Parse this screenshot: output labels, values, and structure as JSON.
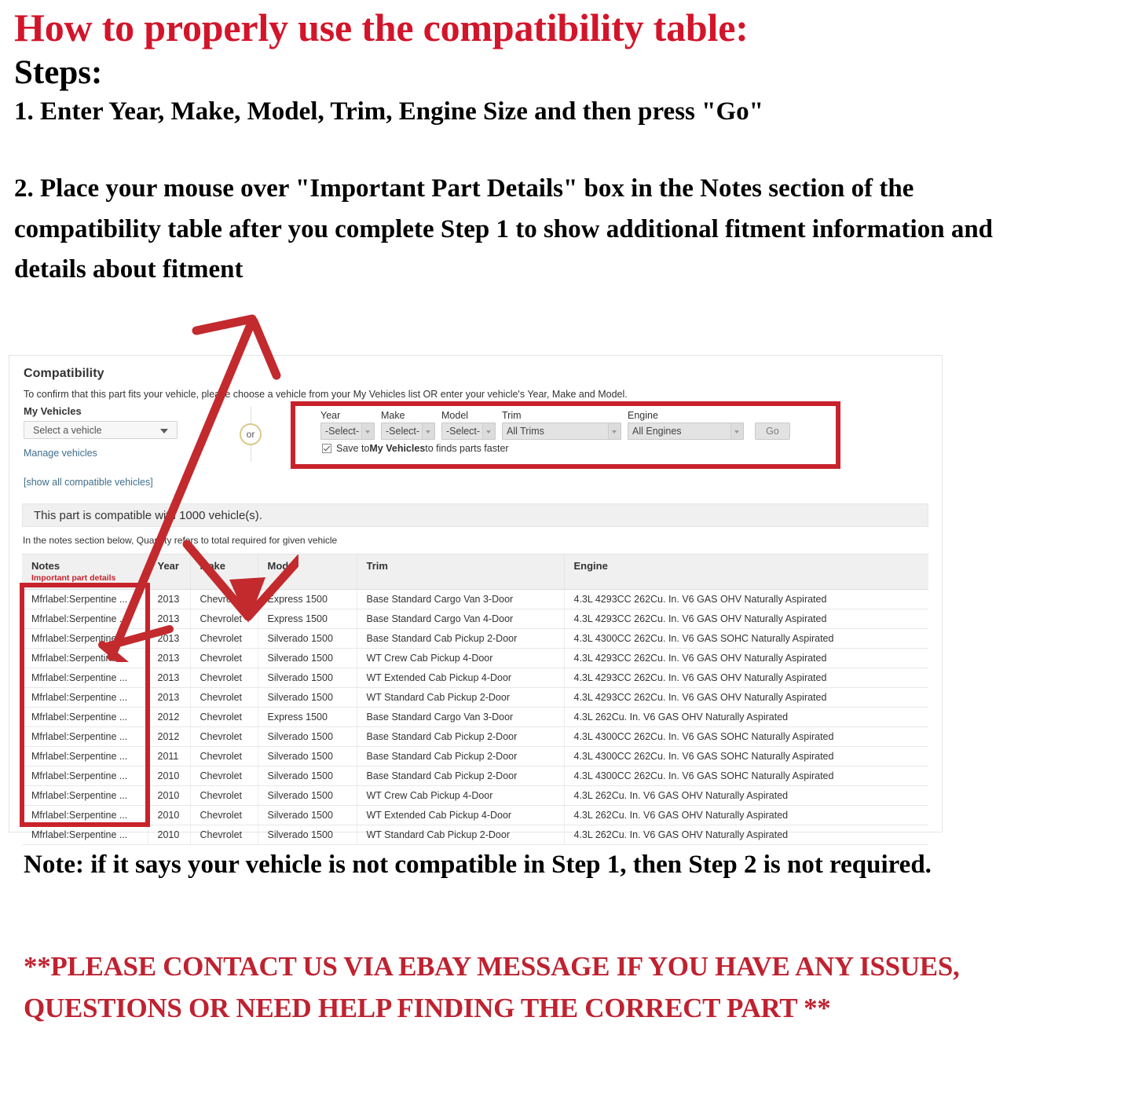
{
  "instructions": {
    "title": "How to properly use the compatibility table:",
    "steps_heading": "Steps:",
    "step1": "1. Enter Year, Make, Model, Trim, Engine Size and then press \"Go\"",
    "step2": "2. Place your mouse over \"Important Part Details\" box in the Notes section of the compatibility table after you complete Step 1 to show additional fitment information and details about fitment"
  },
  "compatibility": {
    "heading": "Compatibility",
    "subtitle": "To confirm that this part fits your vehicle, please choose a vehicle from your My Vehicles list OR enter your vehicle's Year, Make and Model.",
    "my_vehicles_label": "My Vehicles",
    "my_vehicles_value": "Select a vehicle",
    "manage_vehicles_link": "Manage vehicles",
    "show_all_link": "[show all compatible vehicles]",
    "or_label": "or",
    "selectors": [
      {
        "label": "Year",
        "value": "-Select-"
      },
      {
        "label": "Make",
        "value": "-Select-"
      },
      {
        "label": "Model",
        "value": "-Select-"
      },
      {
        "label": "Trim",
        "value": "All Trims"
      },
      {
        "label": "Engine",
        "value": "All Engines"
      }
    ],
    "go_button": "Go",
    "save_checkbox": {
      "checked": true,
      "prefix": "Save to ",
      "bold": "My Vehicles",
      "suffix": " to finds parts faster"
    },
    "compatible_banner": "This part is compatible with 1000 vehicle(s).",
    "quantity_note": "In the notes section below, Quantity refers to total required for given vehicle",
    "table": {
      "headers": {
        "notes": "Notes",
        "notes_sub": "Important part details",
        "year": "Year",
        "make": "Make",
        "model": "Model",
        "trim": "Trim",
        "engine": "Engine"
      },
      "rows": [
        {
          "notes": "Mfrlabel:Serpentine ...",
          "year": "2013",
          "make": "Chevrolet",
          "model": "Express 1500",
          "trim": "Base Standard Cargo Van 3-Door",
          "engine": "4.3L 4293CC 262Cu. In. V6 GAS OHV Naturally Aspirated"
        },
        {
          "notes": "Mfrlabel:Serpentine ...",
          "year": "2013",
          "make": "Chevrolet",
          "model": "Express 1500",
          "trim": "Base Standard Cargo Van 4-Door",
          "engine": "4.3L 4293CC 262Cu. In. V6 GAS OHV Naturally Aspirated"
        },
        {
          "notes": "Mfrlabel:Serpentine ...",
          "year": "2013",
          "make": "Chevrolet",
          "model": "Silverado 1500",
          "trim": "Base Standard Cab Pickup 2-Door",
          "engine": "4.3L 4300CC 262Cu. In. V6 GAS SOHC Naturally Aspirated"
        },
        {
          "notes": "Mfrlabel:Serpentine ...",
          "year": "2013",
          "make": "Chevrolet",
          "model": "Silverado 1500",
          "trim": "WT Crew Cab Pickup 4-Door",
          "engine": "4.3L 4293CC 262Cu. In. V6 GAS OHV Naturally Aspirated"
        },
        {
          "notes": "Mfrlabel:Serpentine ...",
          "year": "2013",
          "make": "Chevrolet",
          "model": "Silverado 1500",
          "trim": "WT Extended Cab Pickup 4-Door",
          "engine": "4.3L 4293CC 262Cu. In. V6 GAS OHV Naturally Aspirated"
        },
        {
          "notes": "Mfrlabel:Serpentine ...",
          "year": "2013",
          "make": "Chevrolet",
          "model": "Silverado 1500",
          "trim": "WT Standard Cab Pickup 2-Door",
          "engine": "4.3L 4293CC 262Cu. In. V6 GAS OHV Naturally Aspirated"
        },
        {
          "notes": "Mfrlabel:Serpentine ...",
          "year": "2012",
          "make": "Chevrolet",
          "model": "Express 1500",
          "trim": "Base Standard Cargo Van 3-Door",
          "engine": "4.3L 262Cu. In. V6 GAS OHV Naturally Aspirated"
        },
        {
          "notes": "Mfrlabel:Serpentine ...",
          "year": "2012",
          "make": "Chevrolet",
          "model": "Silverado 1500",
          "trim": "Base Standard Cab Pickup 2-Door",
          "engine": "4.3L 4300CC 262Cu. In. V6 GAS SOHC Naturally Aspirated"
        },
        {
          "notes": "Mfrlabel:Serpentine ...",
          "year": "2011",
          "make": "Chevrolet",
          "model": "Silverado 1500",
          "trim": "Base Standard Cab Pickup 2-Door",
          "engine": "4.3L 4300CC 262Cu. In. V6 GAS SOHC Naturally Aspirated"
        },
        {
          "notes": "Mfrlabel:Serpentine ...",
          "year": "2010",
          "make": "Chevrolet",
          "model": "Silverado 1500",
          "trim": "Base Standard Cab Pickup 2-Door",
          "engine": "4.3L 4300CC 262Cu. In. V6 GAS SOHC Naturally Aspirated"
        },
        {
          "notes": "Mfrlabel:Serpentine ...",
          "year": "2010",
          "make": "Chevrolet",
          "model": "Silverado 1500",
          "trim": "WT Crew Cab Pickup 4-Door",
          "engine": "4.3L 262Cu. In. V6 GAS OHV Naturally Aspirated"
        },
        {
          "notes": "Mfrlabel:Serpentine ...",
          "year": "2010",
          "make": "Chevrolet",
          "model": "Silverado 1500",
          "trim": "WT Extended Cab Pickup 4-Door",
          "engine": "4.3L 262Cu. In. V6 GAS OHV Naturally Aspirated"
        },
        {
          "notes": "Mfrlabel:Serpentine ...",
          "year": "2010",
          "make": "Chevrolet",
          "model": "Silverado 1500",
          "trim": "WT Standard Cab Pickup 2-Door",
          "engine": "4.3L 262Cu. In. V6 GAS OHV Naturally Aspirated"
        }
      ]
    }
  },
  "footer": {
    "note": "Note: if it says your vehicle is not compatible in Step 1, then Step 2 is not required.",
    "contact": "**PLEASE CONTACT US VIA EBAY MESSAGE IF YOU HAVE ANY ISSUES, QUESTIONS OR NEED HELP FINDING THE CORRECT PART **"
  },
  "colors": {
    "heading_red": "#d2152a",
    "annotation_red": "#c8232c",
    "contact_red": "#bf2230",
    "link_blue": "#3f6e8c",
    "notes_sub_red": "#c5232c"
  }
}
